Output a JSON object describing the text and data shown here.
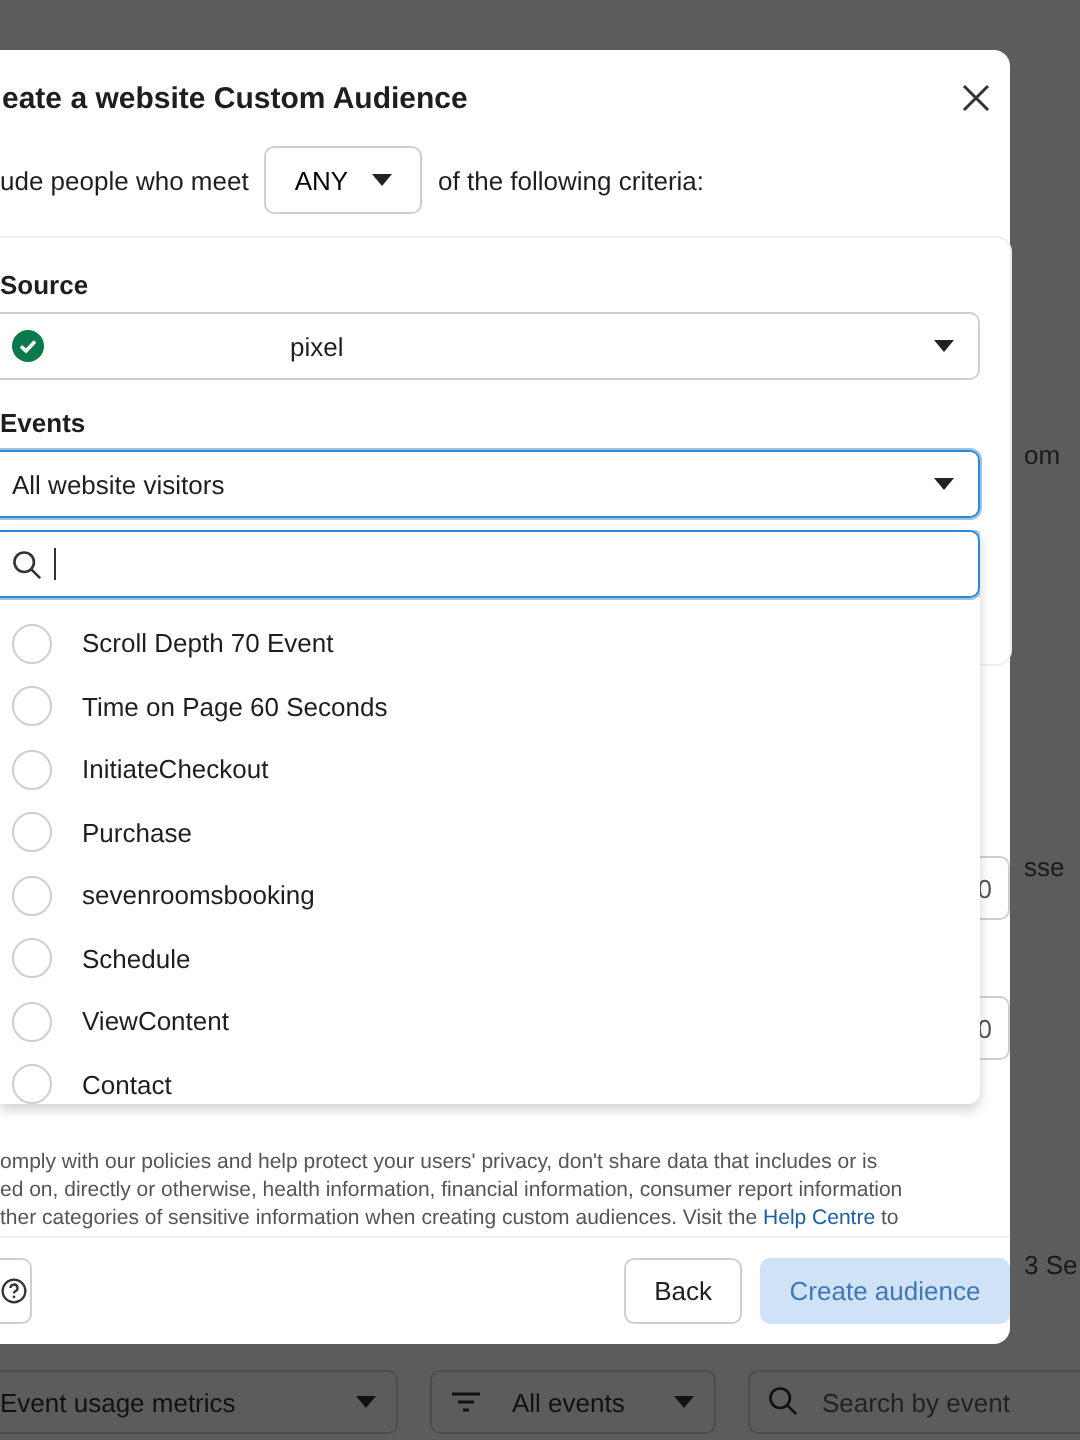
{
  "dialog": {
    "title": "eate a website Custom Audience",
    "criteria": {
      "prefix": "ude people who meet",
      "match": "ANY",
      "suffix": "of the following criteria:"
    },
    "source": {
      "label": "Source",
      "value": "pixel",
      "verified": true
    },
    "events": {
      "label": "Events",
      "value": "All website visitors"
    },
    "event_options": [
      {
        "label": "Scroll Depth 70 Event",
        "selected": false
      },
      {
        "label": "Time on Page 60 Seconds",
        "selected": false
      },
      {
        "label": "InitiateCheckout",
        "selected": false
      },
      {
        "label": "Purchase",
        "selected": false
      },
      {
        "label": "sevenroomsbooking",
        "selected": false
      },
      {
        "label": "Schedule",
        "selected": false
      },
      {
        "label": "ViewContent",
        "selected": false
      },
      {
        "label": "Contact",
        "selected": false
      }
    ],
    "hidden_fields": [
      {
        "value": "0"
      },
      {
        "value": "0"
      }
    ],
    "notice": {
      "lines": [
        "omply with our policies and help protect your users' privacy, don't share data that includes or is",
        "ed on, directly or otherwise, health information, financial information, consumer report information",
        {
          "text": "ther categories of sensitive information when creating custom audiences. Visit the",
          "link": "Help Centre",
          "after": "to"
        }
      ]
    },
    "buttons": [
      {
        "label": "Back",
        "disabled": false
      },
      {
        "label": "Create audience",
        "disabled": true
      }
    ]
  },
  "background": {
    "snippets": [
      "om",
      "sse",
      "3 Se"
    ],
    "toolbar": {
      "metric": "Event usage metrics",
      "filter": "All events",
      "search_placeholder": "Search by event"
    }
  }
}
